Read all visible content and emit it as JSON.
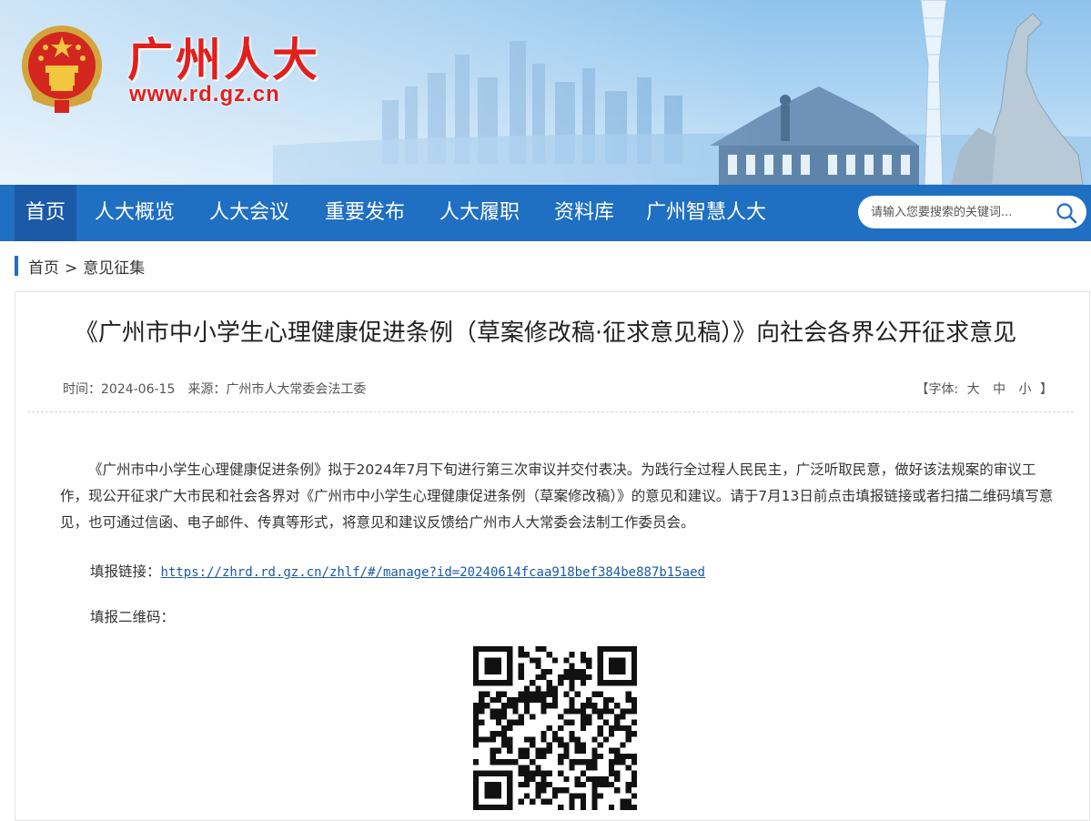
{
  "header": {
    "site_name": "广州人大",
    "site_url": "www.rd.gz.cn",
    "emblem_icon": "national-emblem-icon"
  },
  "nav": {
    "items": [
      {
        "label": "首页",
        "active": true
      },
      {
        "label": "人大概览"
      },
      {
        "label": "人大会议"
      },
      {
        "label": "重要发布"
      },
      {
        "label": "人大履职"
      },
      {
        "label": "资料库"
      },
      {
        "label": "广州智慧人大"
      }
    ],
    "search_placeholder": "请输入您要搜索的关键词...",
    "search_icon": "search-icon"
  },
  "breadcrumb": {
    "home": "首页",
    "separator": ">",
    "current": "意见征集"
  },
  "article": {
    "title": "《广州市中小学生心理健康促进条例（草案修改稿·征求意见稿）》向社会各界公开征求意见",
    "date_label": "时间：2024-06-15",
    "source_label": "来源：广州市人大常委会法工委",
    "font_size": {
      "open": "【字体:",
      "large": "大",
      "medium": "中",
      "small": "小",
      "close": "】"
    },
    "body": "《广州市中小学生心理健康促进条例》拟于2024年7月下旬进行第三次审议并交付表决。为践行全过程人民民主，广泛听取民意，做好该法规案的审议工作，现公开征求广大市民和社会各界对《广州市中小学生心理健康促进条例（草案修改稿）》的意见和建议。请于7月13日前点击填报链接或者扫描二维码填写意见，也可通过信函、电子邮件、传真等形式，将意见和建议反馈给广州市人大常委会法制工作委员会。",
    "link_label": "填报链接：",
    "link_url": "https://zhrd.rd.gz.cn/zhlf/#/manage?id=20240614fcaa918bef384be887b15aed",
    "qr_label": "填报二维码："
  },
  "colors": {
    "nav_bg": "#1f6fc2",
    "nav_active": "#1a5aa6",
    "brand_red": "#e1201e",
    "link": "#1a5aa6"
  }
}
